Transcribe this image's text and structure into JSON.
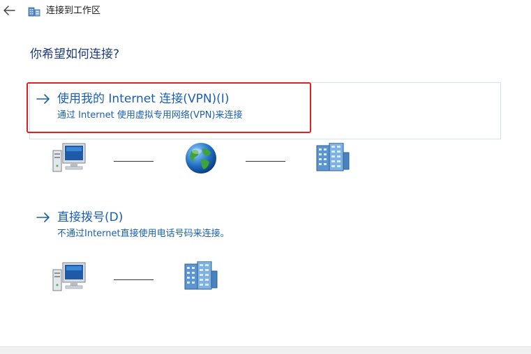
{
  "window": {
    "title": "连接到工作区"
  },
  "page": {
    "question": "你希望如何连接?"
  },
  "options": [
    {
      "title": "使用我的 Internet 连接(VPN)(I)",
      "description": "通过 Internet 使用虚拟专用网络(VPN)来连接",
      "highlighted": true,
      "diagram": [
        "computer-icon",
        "globe-icon",
        "server-icon"
      ]
    },
    {
      "title": "直接拨号(D)",
      "description": "不通过Internet直接使用电话号码来连接。",
      "highlighted": false,
      "diagram": [
        "computer-icon",
        "server-icon"
      ]
    }
  ],
  "colors": {
    "link": "#1a5fb4",
    "heading": "#1e3a78",
    "highlight": "#e0201c",
    "option_border": "#cfe3f5"
  }
}
